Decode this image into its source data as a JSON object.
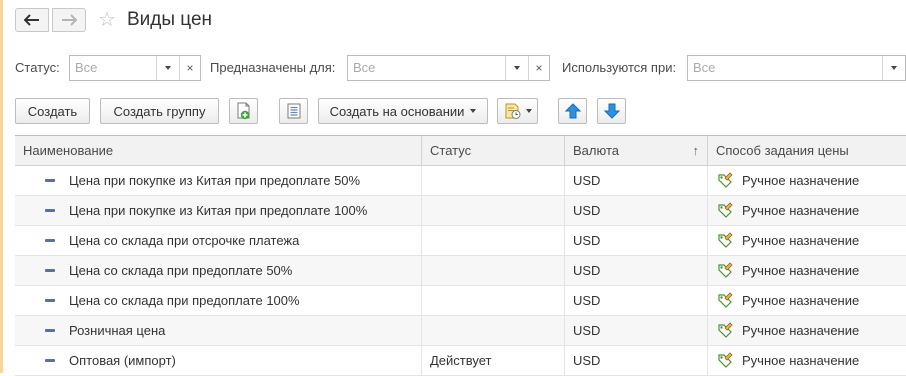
{
  "window": {
    "title": "Виды цен"
  },
  "filters": [
    {
      "label": "Статус:",
      "value": "Все",
      "has_clear": true
    },
    {
      "label": "Предназначены для:",
      "value": "Все",
      "has_clear": true
    },
    {
      "label": "Используются при:",
      "value": "Все",
      "has_clear": false
    }
  ],
  "toolbar": {
    "create_label": "Создать",
    "create_group_label": "Создать группу",
    "create_based_label": "Создать на основании"
  },
  "icons": {
    "back": "arrow-left-icon",
    "forward": "arrow-right-icon",
    "favorite": "star-icon",
    "copy": "add-document-icon",
    "list": "list-icon",
    "report": "report-menu-icon",
    "move_up": "arrow-up-icon",
    "move_down": "arrow-down-icon",
    "item": "item-dash-icon",
    "manual": "pencil-tag-icon"
  },
  "colors": {
    "accent_blue": "#2f8fe0",
    "green_plus": "#3aa53a",
    "item_dash": "#5a6ea6"
  },
  "table": {
    "columns": [
      "Наименование",
      "Статус",
      "Валюта",
      "Способ задания цены"
    ],
    "sorted_column": "Валюта",
    "sort_direction": "ascending",
    "rows": [
      {
        "name": "Цена при покупке из Китая при предоплате 50%",
        "status": "",
        "currency": "USD",
        "method": "Ручное назначение"
      },
      {
        "name": "Цена при покупке из Китая при предоплате 100%",
        "status": "",
        "currency": "USD",
        "method": "Ручное назначение"
      },
      {
        "name": "Цена со склада при отсрочке платежа",
        "status": "",
        "currency": "USD",
        "method": "Ручное назначение"
      },
      {
        "name": "Цена со склада при предоплате 50%",
        "status": "",
        "currency": "USD",
        "method": "Ручное назначение"
      },
      {
        "name": "Цена со склада при предоплате 100%",
        "status": "",
        "currency": "USD",
        "method": "Ручное назначение"
      },
      {
        "name": "Розничная цена",
        "status": "",
        "currency": "USD",
        "method": "Ручное назначение"
      },
      {
        "name": "Оптовая (импорт)",
        "status": "Действует",
        "currency": "USD",
        "method": "Ручное назначение"
      }
    ]
  }
}
